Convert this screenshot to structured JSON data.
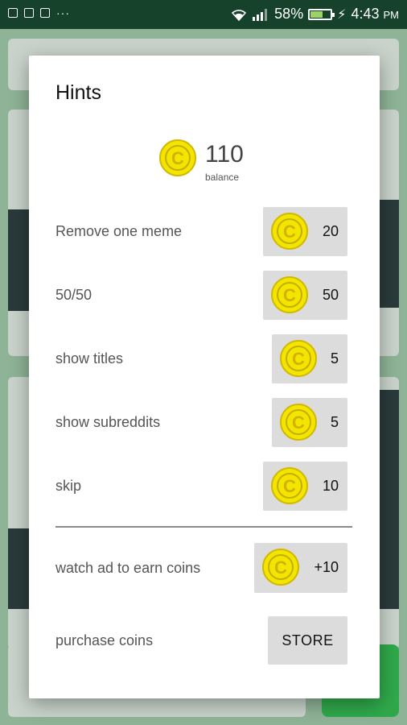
{
  "status_bar": {
    "battery_percent": "58%",
    "time": "4:43",
    "ampm": "PM",
    "battery_level": 0.58
  },
  "dialog": {
    "title": "Hints",
    "balance": {
      "value": "110",
      "label": "balance",
      "coin_symbol": "C"
    },
    "hints": [
      {
        "label": "Remove one meme",
        "price": "20"
      },
      {
        "label": "50/50",
        "price": "50"
      },
      {
        "label": "show titles",
        "price": "5"
      },
      {
        "label": "show subreddits",
        "price": "5"
      },
      {
        "label": "skip",
        "price": "10"
      }
    ],
    "earn": {
      "label": "watch ad to earn coins",
      "reward": "+10"
    },
    "purchase": {
      "label": "purchase coins",
      "button": "STORE"
    }
  },
  "colors": {
    "status_bar": "#16412b",
    "coin_fill": "#f2e600",
    "button_bg": "#dcdcdc"
  },
  "icons": [
    "image-icon",
    "lock-icon",
    "mail-icon",
    "wifi-icon",
    "signal-icon",
    "battery-icon",
    "charging-icon",
    "coin-icon"
  ]
}
